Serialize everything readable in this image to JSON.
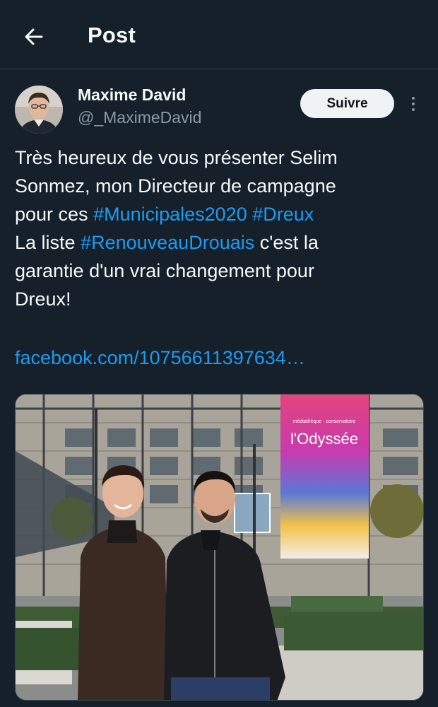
{
  "header": {
    "title": "Post",
    "back_icon": "arrow-left-icon"
  },
  "author": {
    "display_name": "Maxime David",
    "handle": "@_MaximeDavid",
    "follow_label": "Suivre",
    "more_icon": "more-vertical-icon"
  },
  "tweet": {
    "lines": [
      [
        {
          "t": "Très heureux de vous présenter Selim",
          "h": false
        }
      ],
      [
        {
          "t": "Sonmez, mon Directeur de campagne",
          "h": false
        }
      ],
      [
        {
          "t": "pour ces ",
          "h": false
        },
        {
          "t": "#Municipales2020",
          "h": true
        },
        {
          "t": " ",
          "h": false
        },
        {
          "t": "#Dreux",
          "h": true
        }
      ],
      [
        {
          "t": "La liste ",
          "h": false
        },
        {
          "t": "#RenouveauDrouais",
          "h": true
        },
        {
          "t": " c'est la",
          "h": false
        }
      ],
      [
        {
          "t": "garantie d'un vrai changement pour",
          "h": false
        }
      ],
      [
        {
          "t": "Dreux!",
          "h": false
        }
      ]
    ],
    "link": "facebook.com/10756611397634…"
  },
  "photo": {
    "banner_text": "l'Odyssée",
    "banner_small_text": "médiathèque · conservatoire"
  },
  "colors": {
    "background": "#15202b",
    "accent": "#1d9bf0",
    "secondary_text": "#8b98a5",
    "divider": "#38444d"
  }
}
